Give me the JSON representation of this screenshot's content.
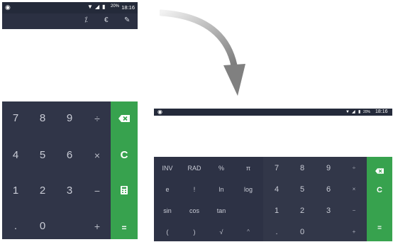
{
  "portrait": {
    "status": {
      "battery": "20%",
      "time": "18:16"
    },
    "toolbar": {
      "icons": [
        "percent-icon",
        "currency-icon",
        "ruler-icon"
      ]
    },
    "keys": {
      "row1": [
        "7",
        "8",
        "9",
        "÷"
      ],
      "row2": [
        "4",
        "5",
        "6",
        "×"
      ],
      "row3": [
        "1",
        "2",
        "3",
        "−"
      ],
      "row4": [
        ".",
        "0",
        "",
        "+"
      ]
    },
    "side": {
      "clear": "C",
      "equals": "="
    }
  },
  "landscape": {
    "status": {
      "battery": "20%",
      "time": "18:16"
    },
    "sci": {
      "row1": [
        "INV",
        "RAD",
        "%",
        "π"
      ],
      "row2": [
        "e",
        "!",
        "ln",
        "log"
      ],
      "row3": [
        "sin",
        "cos",
        "tan",
        ""
      ],
      "row4": [
        "(",
        ")",
        "√",
        "^"
      ]
    },
    "num": {
      "row1": [
        "7",
        "8",
        "9",
        "÷"
      ],
      "row2": [
        "4",
        "5",
        "6",
        "×"
      ],
      "row3": [
        "1",
        "2",
        "3",
        "−"
      ],
      "row4": [
        ".",
        "0",
        "",
        "+"
      ]
    },
    "side": {
      "clear": "C",
      "equals": "="
    }
  },
  "colors": {
    "accent_green": "#37a24e",
    "pad_dark": "#303548",
    "arrow_gray": "#8a8a8a"
  }
}
